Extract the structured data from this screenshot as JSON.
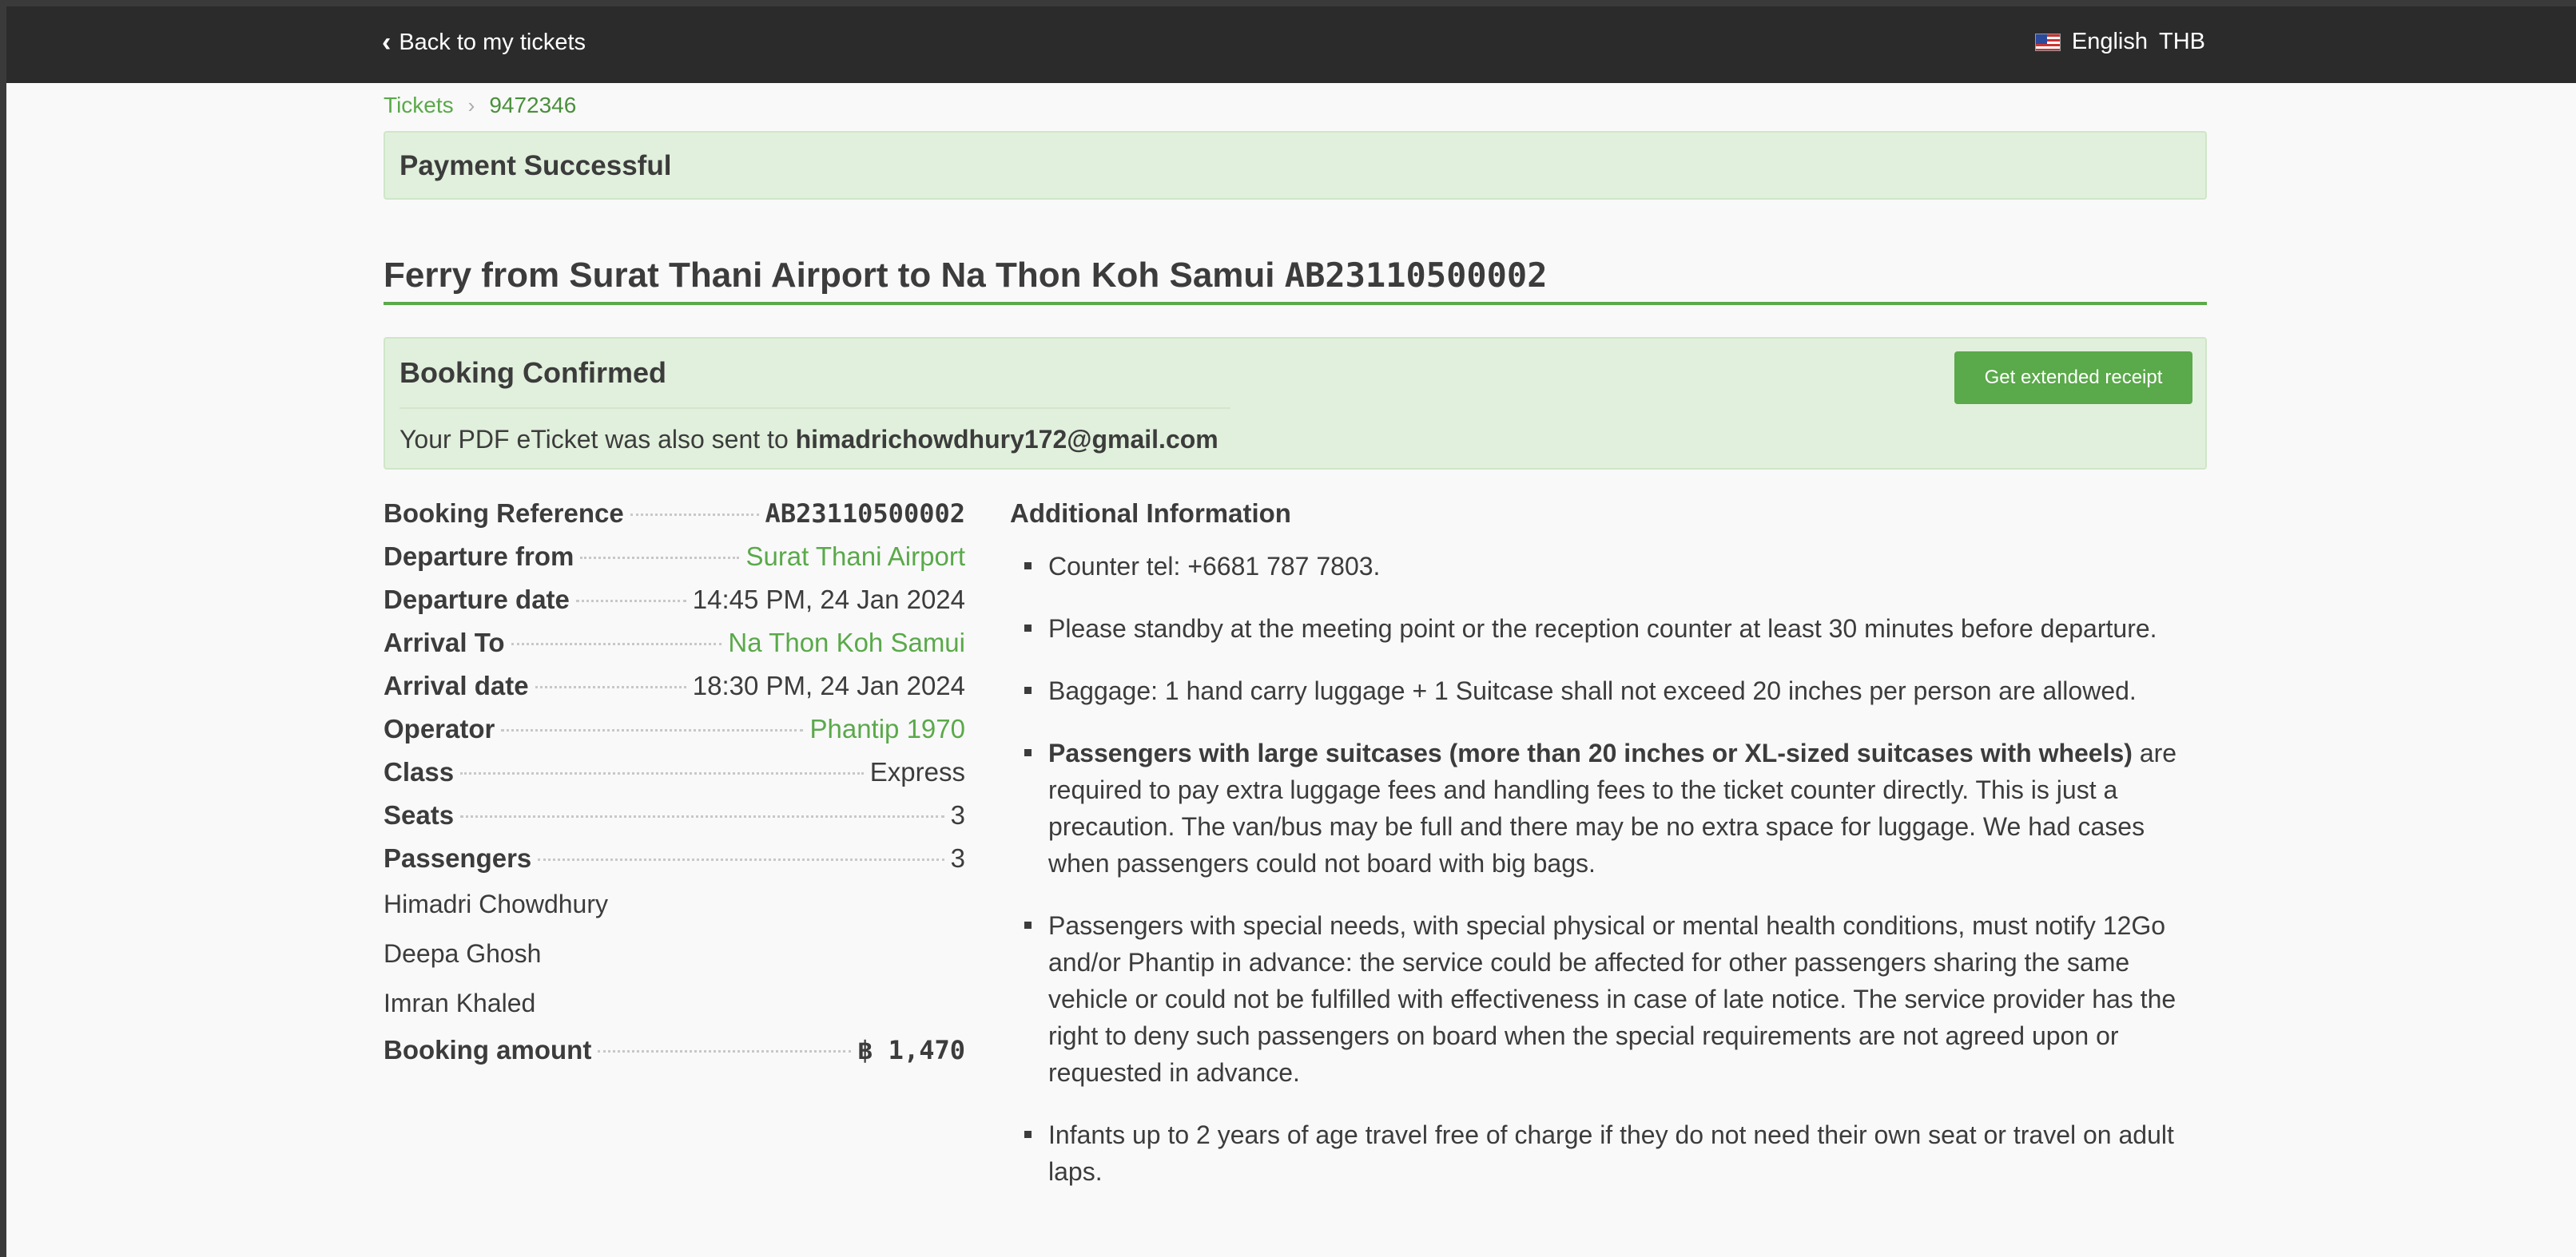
{
  "topbar": {
    "back_label": "Back to my tickets",
    "language": "English",
    "currency": "THB"
  },
  "breadcrumb": {
    "root": "Tickets",
    "current": "9472346"
  },
  "payment_alert": "Payment Successful",
  "title": {
    "text": "Ferry from Surat Thani Airport to Na Thon Koh Samui",
    "code": "AB23110500002"
  },
  "confirmation": {
    "heading": "Booking Confirmed",
    "message_prefix": "Your PDF eTicket was also sent to",
    "email": "himadrichowdhury172@gmail.com",
    "receipt_button": "Get extended receipt"
  },
  "details": [
    {
      "label": "Booking Reference",
      "value": "AB23110500002"
    },
    {
      "label": "Departure from",
      "value": "Surat Thani Airport"
    },
    {
      "label": "Departure date",
      "value": "14:45 PM, 24 Jan 2024"
    },
    {
      "label": "Arrival To",
      "value": "Na Thon Koh Samui"
    },
    {
      "label": "Arrival date",
      "value": "18:30 PM, 24 Jan 2024"
    },
    {
      "label": "Operator",
      "value": "Phantip 1970"
    },
    {
      "label": "Class",
      "value": "Express"
    },
    {
      "label": "Seats",
      "value": "3"
    },
    {
      "label": "Passengers",
      "value": "3"
    }
  ],
  "passengers": [
    "Himadri Chowdhury",
    "Deepa Ghosh",
    "Imran Khaled"
  ],
  "amount": {
    "label": "Booking amount",
    "value": "฿ 1,470"
  },
  "additional": {
    "heading": "Additional Information",
    "items": [
      {
        "bold": "",
        "text": "Counter tel: +6681 787 7803."
      },
      {
        "bold": "",
        "text": "Please standby at the meeting point or the reception counter at least 30 minutes before departure."
      },
      {
        "bold": "",
        "text": "Baggage: 1 hand carry luggage + 1 Suitcase shall not exceed 20 inches per person are allowed."
      },
      {
        "bold": "Passengers with large suitcases (more than 20 inches or XL-sized suitcases with wheels)",
        "text": " are required to pay extra luggage fees and handling fees to the ticket counter directly. This is just a precaution. The van/bus may be full and there may be no extra space for luggage. We had cases when passengers could not board with big bags."
      },
      {
        "bold": "",
        "text": "Passengers with special needs, with special physical or mental health conditions, must notify 12Go and/or Phantip in advance: the service could be affected for other passengers sharing the same vehicle or could not be fulfilled with effectiveness in case of late notice. The service provider has the right to deny such passengers on board when the special requirements are not agreed upon or requested in advance."
      },
      {
        "bold": "",
        "text": "Infants up to 2 years of age travel free of charge if they do not need their own seat or travel on adult laps."
      }
    ]
  }
}
